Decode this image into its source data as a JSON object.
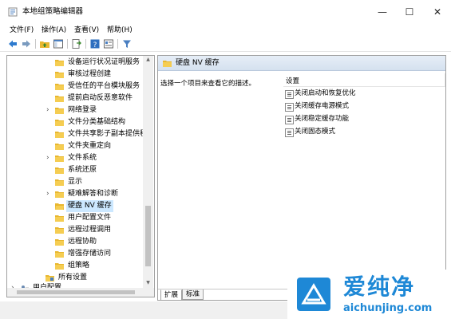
{
  "window": {
    "title": "本地组策略编辑器",
    "minimize": "—",
    "maximize": "☐",
    "close": "✕"
  },
  "menu": [
    {
      "label": "文件(F)"
    },
    {
      "label": "操作(A)"
    },
    {
      "label": "查看(V)"
    },
    {
      "label": "帮助(H)"
    }
  ],
  "toolbar": [
    "back-arrow-icon",
    "forward-arrow-icon",
    "folder-up-icon",
    "show-hide-tree-icon",
    "export-list-icon",
    "help-icon",
    "properties-icon",
    "filter-icon"
  ],
  "tree": {
    "items": [
      {
        "label": "设备运行状况证明服务",
        "expandable": false
      },
      {
        "label": "审核过程创建",
        "expandable": false
      },
      {
        "label": "受信任的平台模块服务",
        "expandable": false
      },
      {
        "label": "提前启动反恶意软件",
        "expandable": false
      },
      {
        "label": "网络登录",
        "expandable": true
      },
      {
        "label": "文件分类基础结构",
        "expandable": false
      },
      {
        "label": "文件共享影子副本提供程",
        "expandable": false
      },
      {
        "label": "文件夹重定向",
        "expandable": false
      },
      {
        "label": "文件系统",
        "expandable": true
      },
      {
        "label": "系统还原",
        "expandable": false
      },
      {
        "label": "显示",
        "expandable": false
      },
      {
        "label": "疑难解答和诊断",
        "expandable": true
      },
      {
        "label": "硬盘 NV 缓存",
        "expandable": false,
        "selected": true
      },
      {
        "label": "用户配置文件",
        "expandable": false
      },
      {
        "label": "远程过程调用",
        "expandable": false
      },
      {
        "label": "远程协助",
        "expandable": false
      },
      {
        "label": "增强存储访问",
        "expandable": false
      },
      {
        "label": "组策略",
        "expandable": false
      }
    ],
    "all_settings": "所有设置",
    "user_config": "用户配置"
  },
  "right": {
    "header": "硬盘 NV 缓存",
    "description": "选择一个项目来查看它的描述。",
    "column": "设置",
    "settings": [
      {
        "label": "关闭启动和恢复优化"
      },
      {
        "label": "关闭缓存电源模式"
      },
      {
        "label": "关闭稳定缓存功能"
      },
      {
        "label": "关闭固态模式"
      }
    ],
    "tabs": [
      {
        "label": "扩展"
      },
      {
        "label": "标准"
      }
    ]
  },
  "watermark": {
    "brand": "爱纯净",
    "site": "aichunjing.com"
  },
  "colors": {
    "selection": "#cce8ff",
    "folder": "#e8b730",
    "brand": "#1e88d6"
  }
}
